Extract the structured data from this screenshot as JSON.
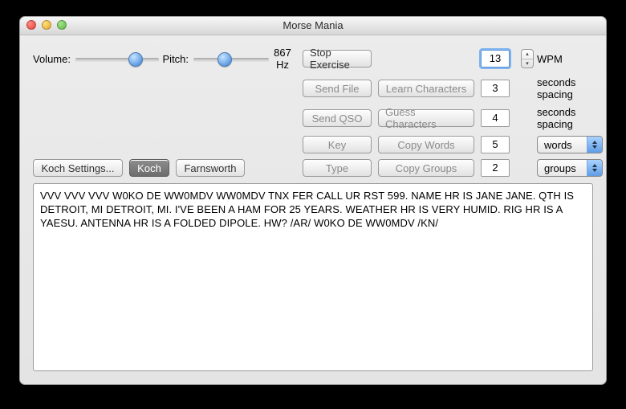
{
  "window": {
    "title": "Morse Mania"
  },
  "sliders": {
    "volume_label": "Volume:",
    "pitch_label": "Pitch:",
    "pitch_readout": "867 Hz"
  },
  "buttons": {
    "stop_exercise": "Stop Exercise",
    "send_file": "Send File",
    "learn_characters": "Learn Characters",
    "send_qso": "Send QSO",
    "guess_characters": "Guess Characters",
    "key": "Key",
    "copy_words": "Copy Words",
    "type": "Type",
    "copy_groups": "Copy Groups",
    "koch_settings": "Koch Settings...",
    "koch": "Koch",
    "farnsworth": "Farnsworth"
  },
  "fields": {
    "wpm": {
      "value": "13",
      "suffix": "WPM"
    },
    "learn_spacing": {
      "value": "3",
      "suffix": "seconds spacing"
    },
    "guess_spacing": {
      "value": "4",
      "suffix": "seconds spacing"
    },
    "words": {
      "value": "5",
      "select": "words"
    },
    "groups": {
      "value": "2",
      "select": "groups"
    }
  },
  "transcript": "VVV VVV VVV W0KO DE WW0MDV WW0MDV TNX FER CALL UR RST 599.  NAME HR IS JANE JANE. QTH IS DETROIT, MI DETROIT, MI. I'VE BEEN A HAM FOR 25 YEARS. WEATHER HR IS VERY HUMID. RIG HR IS A YAESU. ANTENNA HR IS A FOLDED DIPOLE. HW?  /AR/  W0KO DE WW0MDV  /KN/"
}
